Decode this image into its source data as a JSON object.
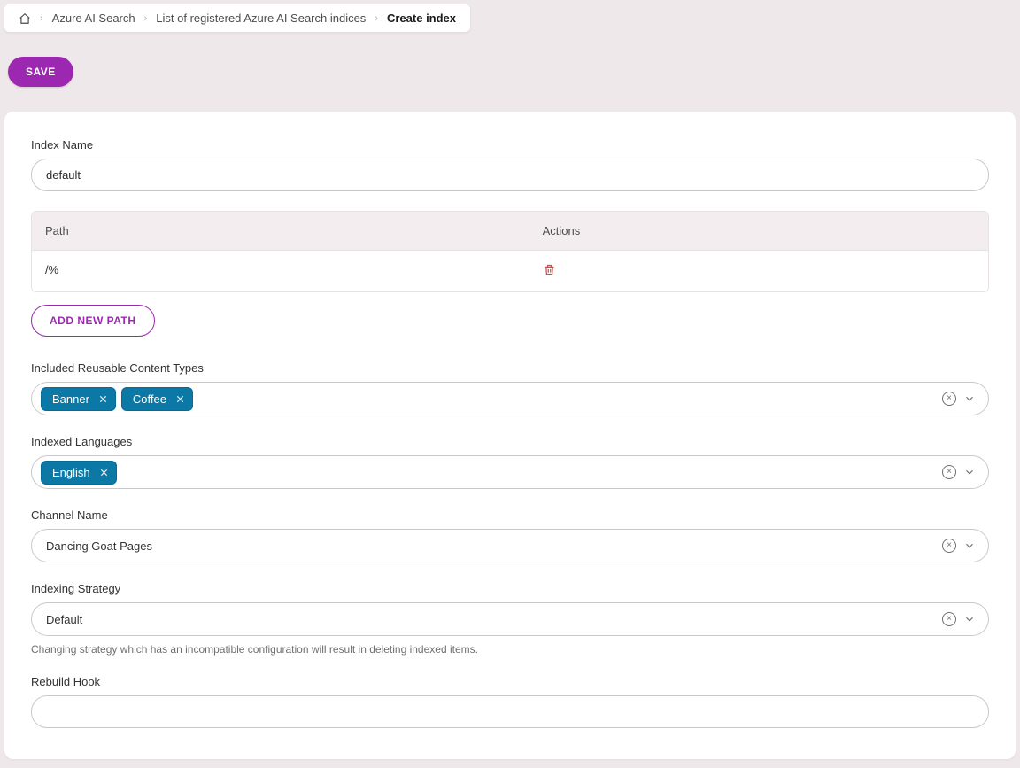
{
  "breadcrumb": {
    "items": [
      {
        "label": "Azure AI Search"
      },
      {
        "label": "List of registered Azure AI Search indices"
      }
    ],
    "current": "Create index"
  },
  "actions": {
    "save": "SAVE"
  },
  "form": {
    "indexName": {
      "label": "Index Name",
      "value": "default"
    },
    "pathTable": {
      "head": {
        "path": "Path",
        "actions": "Actions"
      },
      "rows": [
        {
          "path": "/%"
        }
      ],
      "addButton": "ADD NEW PATH"
    },
    "contentTypes": {
      "label": "Included Reusable Content Types",
      "selected": [
        "Banner",
        "Coffee"
      ]
    },
    "languages": {
      "label": "Indexed Languages",
      "selected": [
        "English"
      ]
    },
    "channel": {
      "label": "Channel Name",
      "value": "Dancing Goat Pages"
    },
    "strategy": {
      "label": "Indexing Strategy",
      "value": "Default",
      "helper": "Changing strategy which has an incompatible configuration will result in deleting indexed items."
    },
    "rebuildHook": {
      "label": "Rebuild Hook",
      "value": ""
    }
  },
  "icons": {
    "clear": "×",
    "chevron": "⌄"
  }
}
